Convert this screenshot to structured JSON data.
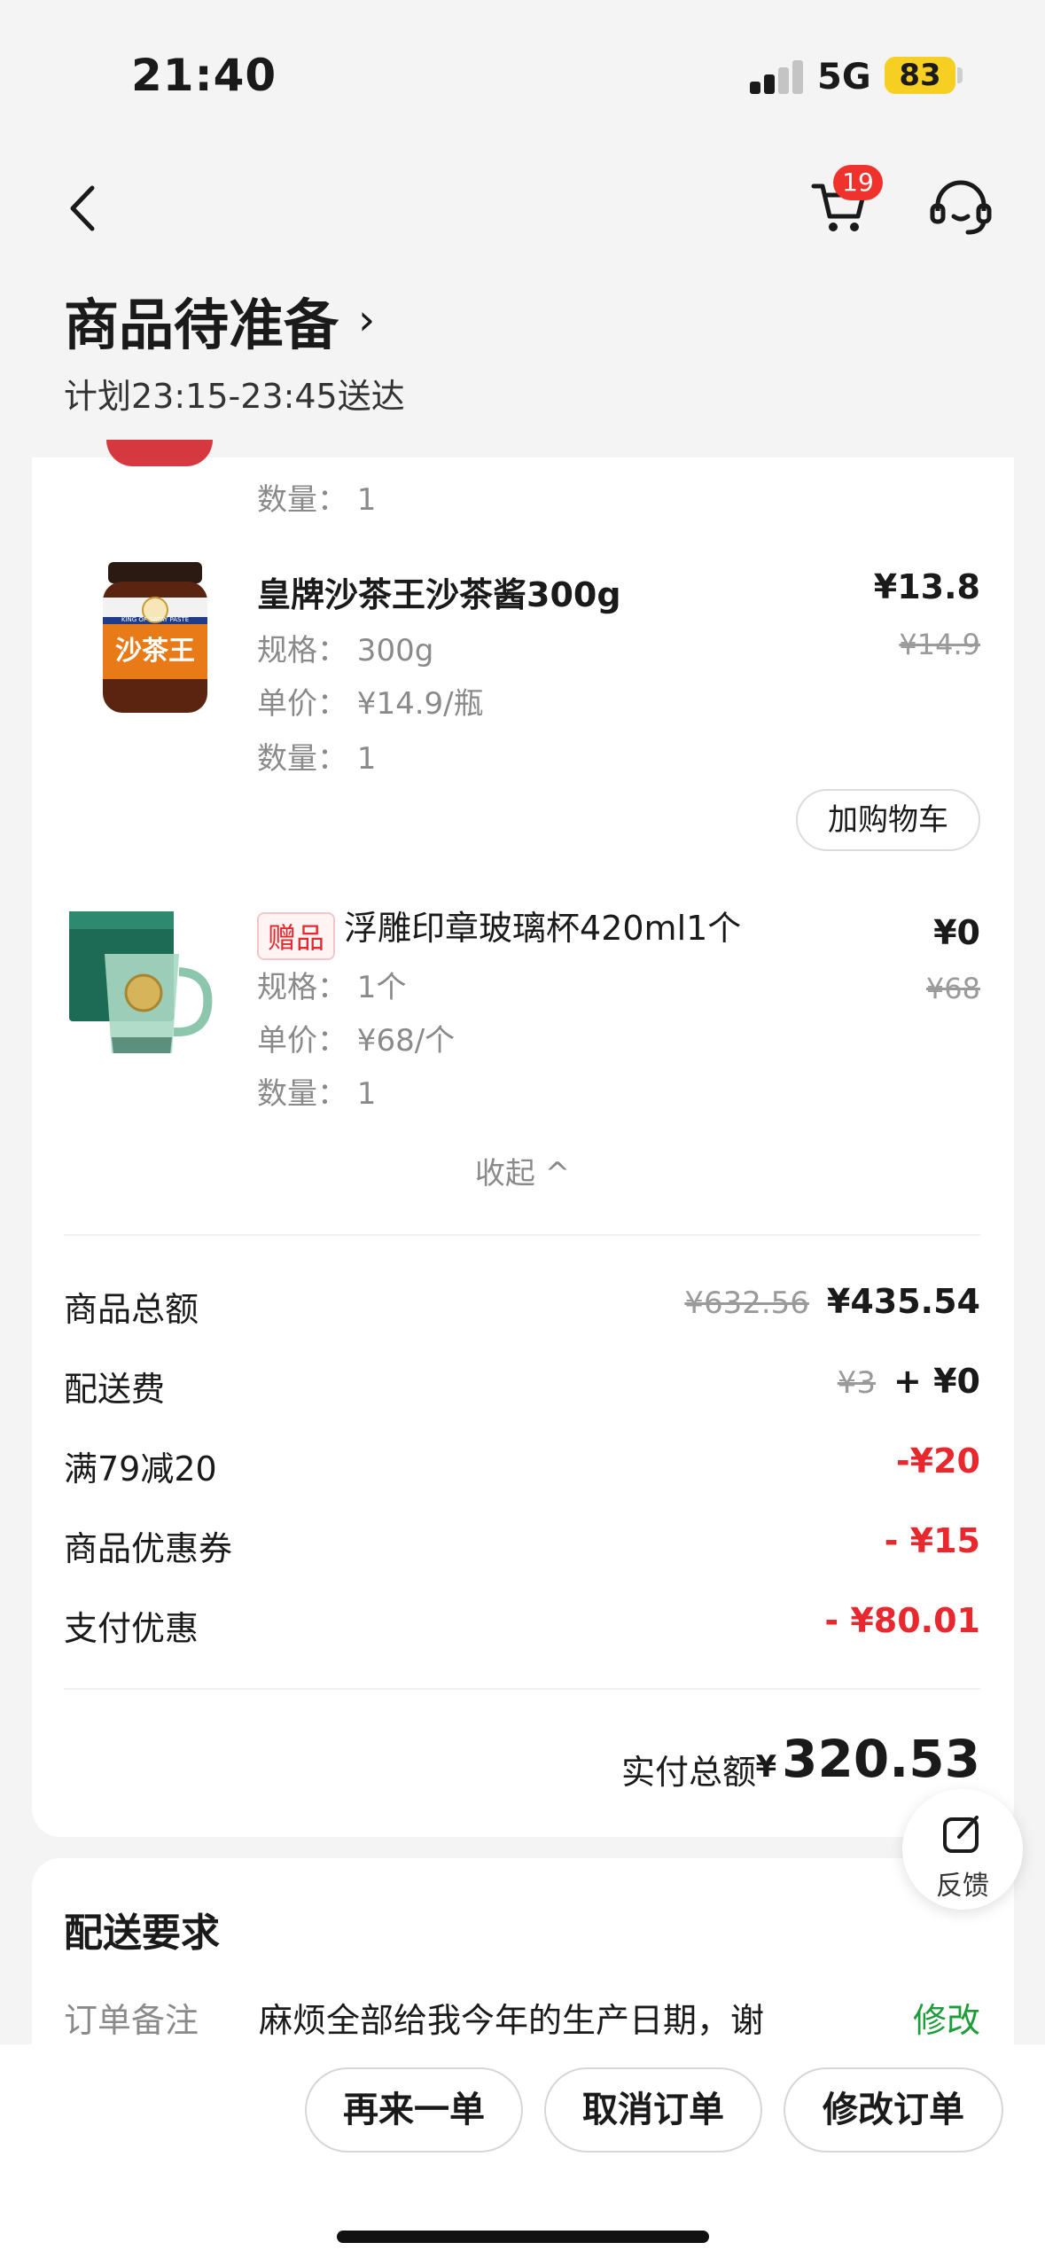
{
  "status": {
    "time": "21:40",
    "network": "5G",
    "battery": "83"
  },
  "header": {
    "cart_count": "19",
    "title": "商品待准备",
    "title_chevron": "›",
    "subtitle": "计划23:15-23:45送达"
  },
  "products_partial": {
    "qty": "数量：  1"
  },
  "products": [
    {
      "name": "皇牌沙茶王沙茶酱300g",
      "spec": "规格：  300g",
      "unit_price": "单价：  ¥14.9/瓶",
      "qty": "数量：  1",
      "price": "¥13.8",
      "original_price": "¥14.9",
      "action": "加购物车",
      "image_label": "沙茶王",
      "image_brand": "KING OF SATAY PASTE"
    },
    {
      "tag": "赠品",
      "name": "浮雕印章玻璃杯420ml1个",
      "spec": "规格：  1个",
      "unit_price": "单价：  ¥68/个",
      "qty": "数量：  1",
      "price": "¥0",
      "original_price": "¥68"
    }
  ],
  "collapse_label": "收起 ^",
  "summary": {
    "goods_total_label": "商品总额",
    "goods_total_original": "¥632.56",
    "goods_total": "¥435.54",
    "delivery_label": "配送费",
    "delivery_original": "¥3",
    "delivery": "+ ¥0",
    "discount_label": "满79减20",
    "discount": "-¥20",
    "coupon_label": "商品优惠券",
    "coupon": "- ¥15",
    "pay_discount_label": "支付优惠",
    "pay_discount": "- ¥80.01",
    "paid_label": "实付总额",
    "paid_currency": "¥",
    "paid_total": "320.53"
  },
  "feedback_label": "反馈",
  "delivery_req": {
    "title": "配送要求",
    "note_label": "订单备注",
    "note_text": "麻烦全部给我今年的生产日期，谢",
    "edit_label": "修改"
  },
  "actions": {
    "reorder": "再来一单",
    "cancel": "取消订单",
    "modify": "修改订单"
  },
  "colors": {
    "accent_red": "#e8282e",
    "green": "#1e9c3a",
    "battery": "#f6cf22"
  }
}
